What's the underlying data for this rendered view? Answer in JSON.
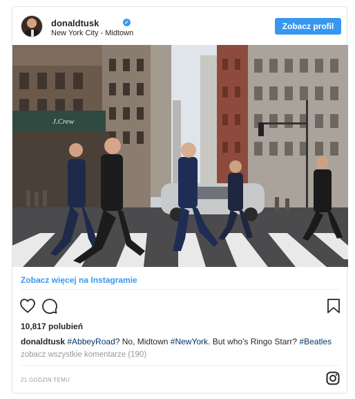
{
  "header": {
    "username": "donaldtusk",
    "verified_mark": "✓",
    "location": "New York City - Midtown",
    "view_profile_label": "Zobacz profil"
  },
  "post": {
    "see_more_label": "Zobacz więcej na Instagramie",
    "likes": "10,817 polubień",
    "caption_user": "donaldtusk",
    "caption_parts": [
      "#AbbeyRoad",
      "? No, Midtown ",
      "#NewYork",
      ". But who's Ringo Starr? ",
      "#Beatles"
    ],
    "comments_label": "zobacz wszystkie komentarze (190)",
    "time_label": "21 GODZIN TEMU"
  },
  "photo": {
    "store_sign": "J.Crew"
  },
  "icons": {
    "like": "heart-icon",
    "comment": "comment-icon",
    "save": "bookmark-icon",
    "instagram": "instagram-logo-icon",
    "verified": "verified-badge-icon"
  },
  "colors": {
    "accent": "#3897f0",
    "hashtag": "#003569",
    "muted": "#999999",
    "text": "#262626"
  }
}
